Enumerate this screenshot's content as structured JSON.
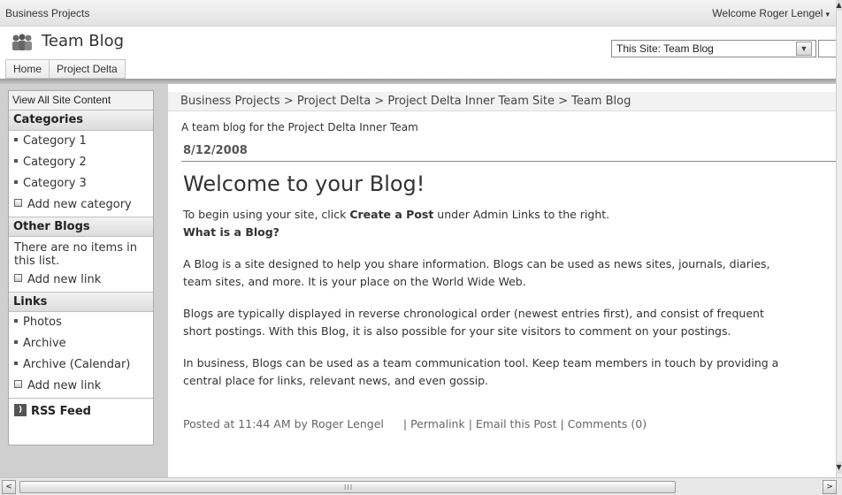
{
  "topbar": {
    "site_crumb": "Business Projects",
    "welcome": "Welcome Roger Lengel",
    "caret": "▾"
  },
  "header": {
    "title": "Team Blog",
    "search_scope": "This Site: Team Blog",
    "tabs": [
      "Home",
      "Project Delta"
    ]
  },
  "quicklaunch": {
    "view_all": "View All Site Content",
    "categories": {
      "heading": "Categories",
      "items": [
        "Category 1",
        "Category 2",
        "Category 3"
      ],
      "add": "Add new category"
    },
    "other_blogs": {
      "heading": "Other Blogs",
      "empty_text": "There are no items in this list.",
      "add": "Add new link"
    },
    "links": {
      "heading": "Links",
      "items": [
        "Photos",
        "Archive",
        "Archive (Calendar)"
      ],
      "add": "Add new link"
    },
    "rss": "RSS Feed"
  },
  "main": {
    "breadcrumb": "Business Projects > Project Delta > Project Delta Inner Team Site > Team Blog",
    "description": "A team blog for the Project Delta Inner Team",
    "date": "8/12/2008",
    "post_title": "Welcome to your Blog!",
    "body": {
      "intro_before": "To begin using your site, click ",
      "intro_bold": "Create a Post",
      "intro_after": " under Admin Links to the right.",
      "question": "What is a Blog?",
      "p1_line1": "A Blog is a site designed to help you share information. Blogs can be used as news sites, journals, diaries,",
      "p1_line2": "team sites, and more. It is your place on the World Wide Web.",
      "p2_line1": "Blogs are typically displayed in reverse chronological order (newest entries first), and consist of frequent",
      "p2_line2": "short postings. With this Blog, it is also possible for your site visitors to comment on your postings.",
      "p3_line1": "In business, Blogs can be used as a team communication tool. Keep team members in touch by providing a",
      "p3_line2": "central place for links, relevant news, and even gossip."
    },
    "footer": {
      "posted": "Posted at 11:44 AM by Roger Lengel",
      "permalink": "Permalink",
      "email": "Email this Post",
      "comments": "Comments (0)"
    }
  },
  "scroll": {
    "left_arrow": "<",
    "right_arrow": ">",
    "grip": "III"
  }
}
